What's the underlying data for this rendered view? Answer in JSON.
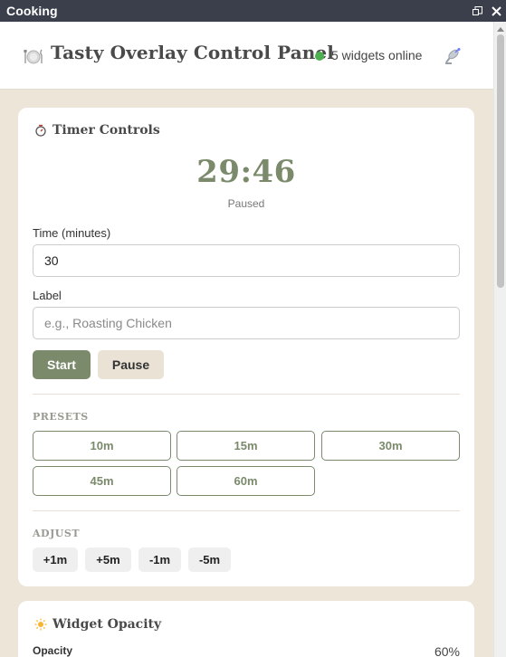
{
  "window": {
    "title": "Cooking",
    "restore_icon": "restore-icon",
    "close_icon": "close-icon"
  },
  "header": {
    "icon": "plate-icon",
    "title": "Tasty Overlay Control Panel",
    "status": {
      "text": "5 widgets online",
      "color": "#4caf50"
    },
    "antenna_icon": "satellite-antenna-icon"
  },
  "timer": {
    "title": "Timer Controls",
    "icon": "stopwatch-icon",
    "display": "29:46",
    "status": "Paused",
    "time_label": "Time (minutes)",
    "time_value": "30",
    "label_label": "Label",
    "label_placeholder": "e.g., Roasting Chicken",
    "start": "Start",
    "pause": "Pause",
    "presets_label": "PRESETS",
    "presets": [
      "10m",
      "15m",
      "30m",
      "45m",
      "60m"
    ],
    "adjust_label": "ADJUST",
    "adjust": [
      "+1m",
      "+5m",
      "-1m",
      "-5m"
    ]
  },
  "opacity": {
    "title": "Widget Opacity",
    "icon": "sun-icon",
    "label": "Opacity",
    "value": "60%"
  },
  "colors": {
    "accent": "#7a8a6b",
    "background": "#ece5d8",
    "titlebar": "#3a3f4b"
  }
}
